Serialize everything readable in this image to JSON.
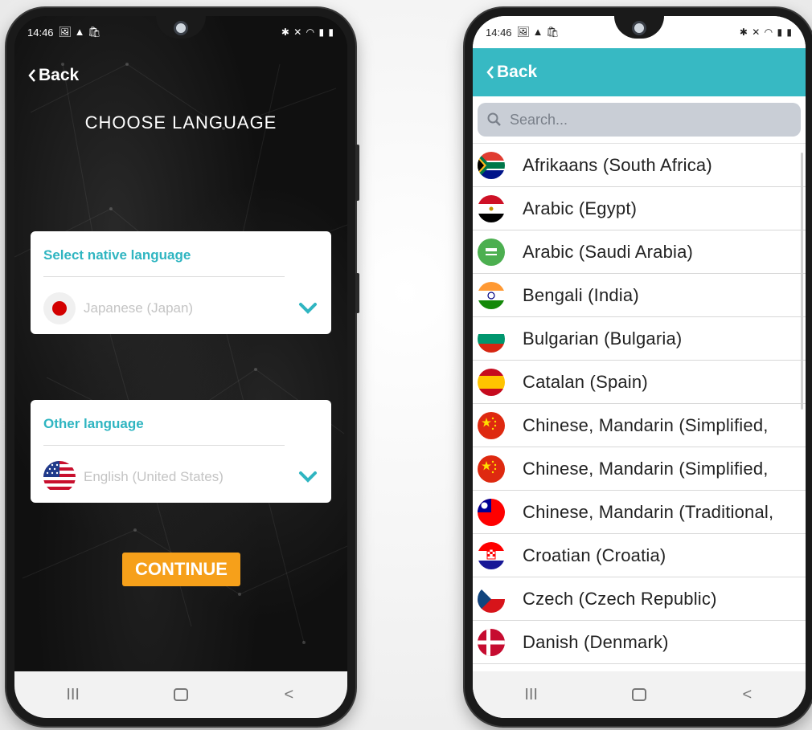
{
  "status_bar": {
    "time": "14:46",
    "left_icons": "🖼 ▲ 🛍",
    "right_icons": "✱ ✕ ◠ ▮ ▮"
  },
  "left_screen": {
    "back_label": "Back",
    "title": "CHOOSE LANGUAGE",
    "native_card": {
      "label": "Select native language",
      "value": "Japanese (Japan)",
      "flag": "japan"
    },
    "other_card": {
      "label": "Other language",
      "value": "English (United States)",
      "flag": "united-states"
    },
    "continue_label": "CONTINUE"
  },
  "right_screen": {
    "back_label": "Back",
    "search": {
      "placeholder": "Search..."
    },
    "languages": [
      {
        "name": "Afrikaans (South Africa)",
        "flag": "south-africa"
      },
      {
        "name": "Arabic (Egypt)",
        "flag": "egypt"
      },
      {
        "name": "Arabic (Saudi Arabia)",
        "flag": "saudi-arabia"
      },
      {
        "name": "Bengali (India)",
        "flag": "india"
      },
      {
        "name": "Bulgarian (Bulgaria)",
        "flag": "bulgaria"
      },
      {
        "name": "Catalan (Spain)",
        "flag": "spain"
      },
      {
        "name": "Chinese, Mandarin (Simplified,",
        "flag": "china"
      },
      {
        "name": "Chinese, Mandarin (Simplified,",
        "flag": "china"
      },
      {
        "name": "Chinese, Mandarin (Traditional,",
        "flag": "taiwan"
      },
      {
        "name": "Croatian (Croatia)",
        "flag": "croatia"
      },
      {
        "name": "Czech (Czech Republic)",
        "flag": "czech-republic"
      },
      {
        "name": "Danish (Denmark)",
        "flag": "denmark"
      },
      {
        "name": "",
        "flag": "partial"
      }
    ]
  },
  "nav_bar": {
    "recents": "III",
    "home": "",
    "back": "<"
  },
  "colors": {
    "accent": "#37b9c3",
    "button": "#f6a01a"
  }
}
